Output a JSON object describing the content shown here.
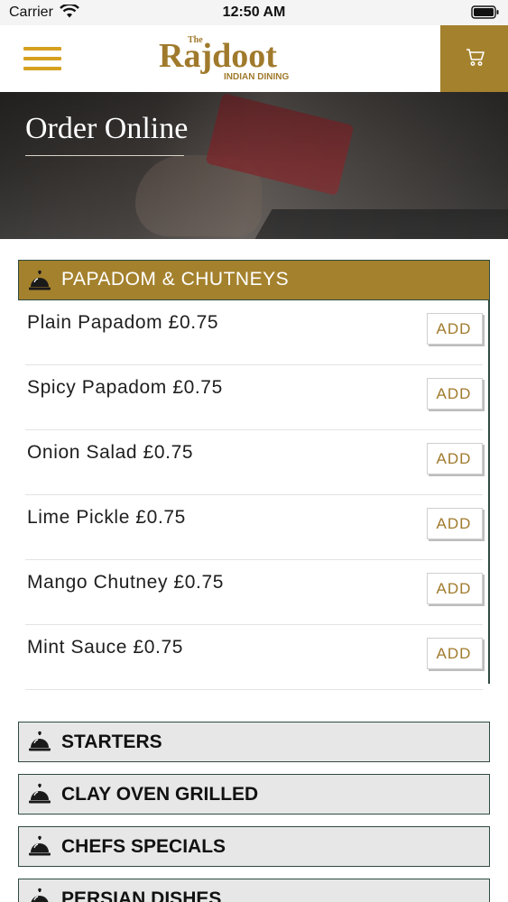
{
  "status_bar": {
    "carrier": "Carrier",
    "time": "12:50 AM",
    "wifi_icon": "wifi-icon",
    "battery_icon": "battery-icon"
  },
  "header": {
    "menu_icon": "hamburger-menu-icon",
    "logo": {
      "the": "The",
      "name": "Rajdoot",
      "subtitle": "INDIAN DINING"
    },
    "cart_icon": "shopping-cart-icon"
  },
  "hero": {
    "title": "Order Online"
  },
  "expanded_section": {
    "icon": "dish-cloche-icon",
    "title": "PAPADOM & CHUTNEYS",
    "add_label": "ADD",
    "items": [
      {
        "label": "Plain Papadom £0.75"
      },
      {
        "label": "Spicy Papadom £0.75"
      },
      {
        "label": "Onion Salad £0.75"
      },
      {
        "label": "Lime Pickle £0.75"
      },
      {
        "label": "Mango Chutney £0.75"
      },
      {
        "label": "Mint Sauce £0.75"
      }
    ]
  },
  "collapsed_sections": [
    {
      "title": "STARTERS"
    },
    {
      "title": "CLAY OVEN GRILLED"
    },
    {
      "title": "CHEFS SPECIALS"
    },
    {
      "title": "PERSIAN DISHES"
    }
  ],
  "colors": {
    "accent_gold": "#a4812d",
    "menu_icon_yellow": "#d6a01f",
    "section_border": "#2e4a40",
    "collapsed_bg": "#e7e7e7"
  }
}
